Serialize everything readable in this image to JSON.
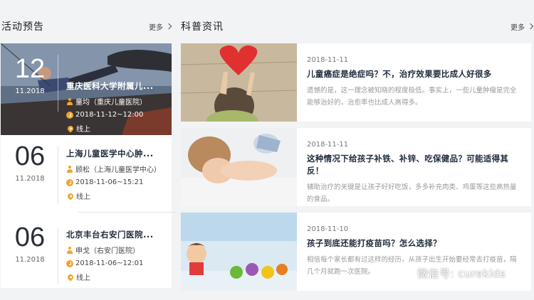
{
  "events_section": {
    "title": "活动预告",
    "more": "更多"
  },
  "news_section": {
    "title": "科普资讯",
    "more": "更多"
  },
  "events": [
    {
      "day": "12",
      "month": "11.2018",
      "name": "重庆医科大学附属儿...",
      "speaker": "童均（重庆儿童医院）",
      "time": "2018-11-12~12:00",
      "location": "线上"
    },
    {
      "day": "06",
      "month": "11.2018",
      "name": "上海儿童医学中心肿...",
      "speaker": "顾松（上海儿童医学中心）",
      "time": "2018-11-06~15:21",
      "location": "线上"
    },
    {
      "day": "06",
      "month": "11.2018",
      "name": "北京丰台右安门医院...",
      "speaker": "申戈（右安门医院）",
      "time": "2018-11-06~12:01",
      "location": "线上"
    }
  ],
  "news": [
    {
      "date": "2018-11-11",
      "title": "儿童癌症是绝症吗？不，治疗效果要比成人好很多",
      "summary": "遗憾的是，这一理念被知晓的程度极低。事实上，一些儿童肿瘤是完全能够治好的，治愈率也比成人高得多。"
    },
    {
      "date": "2018-11-11",
      "title": "这种情况下给孩子补铁、补锌、吃保健品？可能适得其反！",
      "summary": "辅助治疗的关键是让孩子好好吃饭，多多补充肉类、鸡蛋等这些高热量的食品。"
    },
    {
      "date": "2018-11-10",
      "title": "孩子到底还能打疫苗吗？怎么选择？",
      "summary": "相信每个家长都有过这样的经历，从孩子出生开始要经常去打疫苗，隔几个月就跑一次医院。"
    }
  ],
  "watermark": {
    "text": "微信号: curekids"
  },
  "colors": {
    "accent": "#f0a52c",
    "heading": "#1f2a3a"
  }
}
